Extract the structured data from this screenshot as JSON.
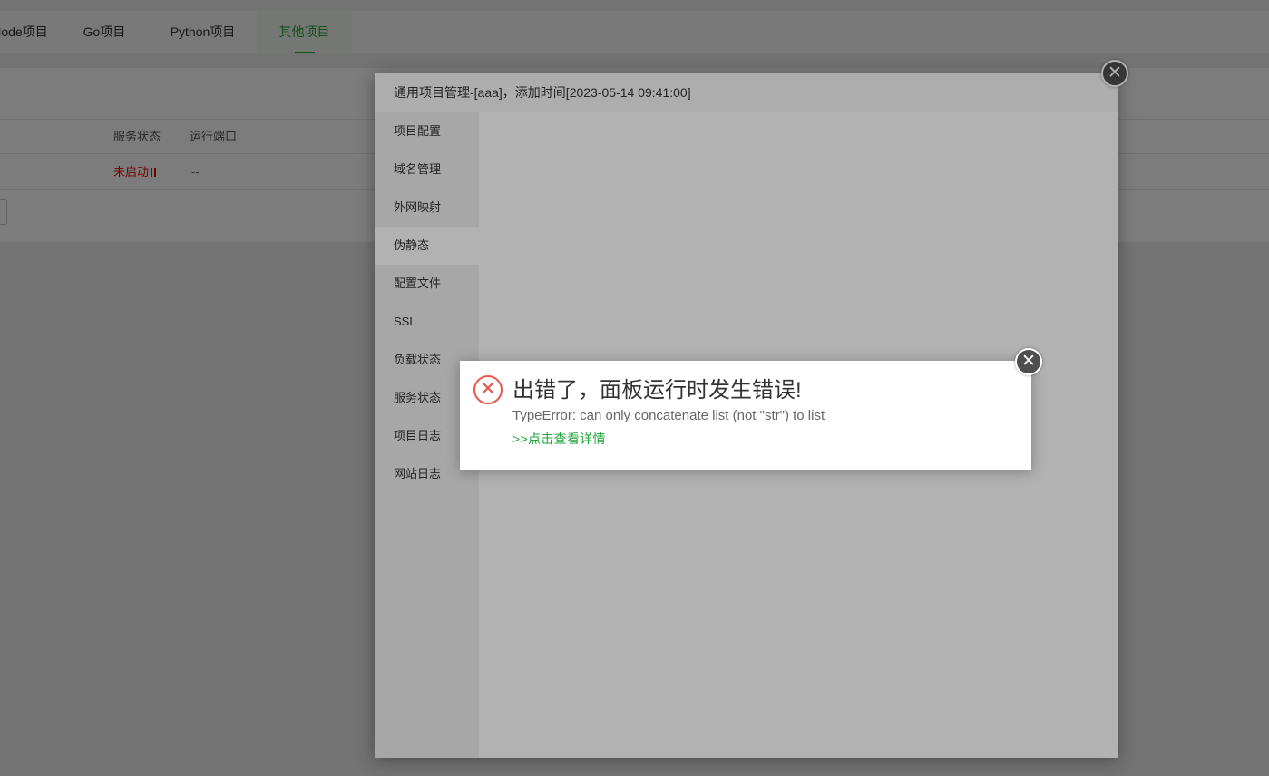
{
  "tabs": [
    {
      "label": "Node项目",
      "active": false
    },
    {
      "label": "Go项目",
      "active": false
    },
    {
      "label": "Python项目",
      "active": false
    },
    {
      "label": "其他项目",
      "active": true
    }
  ],
  "table": {
    "headers": [
      "服务状态",
      "运行端口"
    ],
    "rows": [
      {
        "status": "未启动",
        "port": "--"
      }
    ]
  },
  "dialog": {
    "title": "通用项目管理-[aaa]，添加时间[2023-05-14 09:41:00]",
    "menu": [
      {
        "label": "项目配置",
        "active": false
      },
      {
        "label": "域名管理",
        "active": false
      },
      {
        "label": "外网映射",
        "active": false
      },
      {
        "label": "伪静态",
        "active": true
      },
      {
        "label": "配置文件",
        "active": false
      },
      {
        "label": "SSL",
        "active": false
      },
      {
        "label": "负载状态",
        "active": false
      },
      {
        "label": "服务状态",
        "active": false
      },
      {
        "label": "项目日志",
        "active": false
      },
      {
        "label": "网站日志",
        "active": false
      }
    ],
    "close_glyph": "✕"
  },
  "error": {
    "icon": "error-circle-x-icon",
    "icon_glyph": "✕",
    "title": "出错了，面板运行时发生错误!",
    "detail": "TypeError: can only concatenate list (not \"str\") to list",
    "link": ">>点击查看详情",
    "close_glyph": "✕"
  },
  "colors": {
    "accent": "#20a53a",
    "error": "#e8574e",
    "stopped": "#ef0808"
  }
}
